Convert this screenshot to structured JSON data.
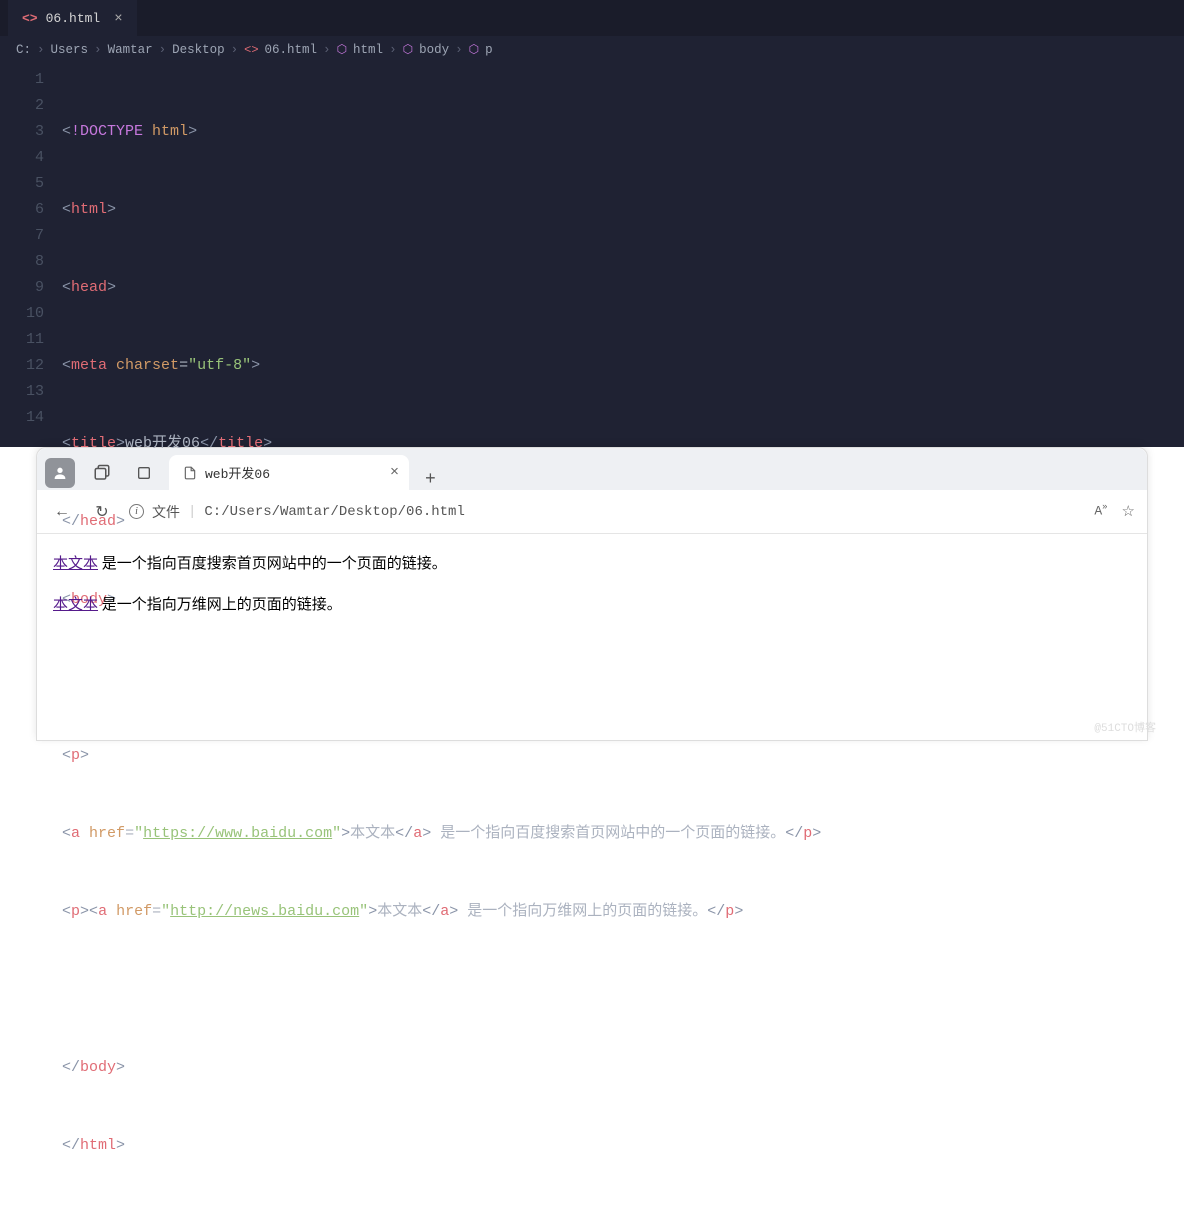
{
  "editor": {
    "tab": {
      "filename": "06.html"
    },
    "breadcrumb": [
      "C:",
      "Users",
      "Wamtar",
      "Desktop",
      "06.html",
      "html",
      "body",
      "p"
    ],
    "lineNumbers": [
      "1",
      "2",
      "3",
      "4",
      "5",
      "6",
      "7",
      "8",
      "9",
      "10",
      "11",
      "12",
      "13",
      "14"
    ],
    "code": {
      "doctype_kw": "!DOCTYPE",
      "html_kw": "html",
      "head": "head",
      "meta": "meta",
      "charset_attr": "charset",
      "charset_val": "\"utf-8\"",
      "title_tag": "title",
      "title_text": "web开发06",
      "body": "body",
      "p": "p",
      "a": "a",
      "href_attr": "href",
      "url1": "https://www.baidu.com",
      "url2": "http://news.baidu.com",
      "link_text": "本文本",
      "para1_text": " 是一个指向百度搜索首页网站中的一个页面的链接。",
      "para2_text": " 是一个指向万维网上的页面的链接。"
    }
  },
  "browser": {
    "tab_title": "web开发06",
    "address": {
      "scheme_label": "文件",
      "path": "C:/Users/Wamtar/Desktop/06.html"
    },
    "font_size_label": "A",
    "content": {
      "link_text": "本文本",
      "p1": " 是一个指向百度搜索首页网站中的一个页面的链接。",
      "p2": " 是一个指向万维网上的页面的链接。"
    }
  },
  "watermark": "@51CTO博客"
}
